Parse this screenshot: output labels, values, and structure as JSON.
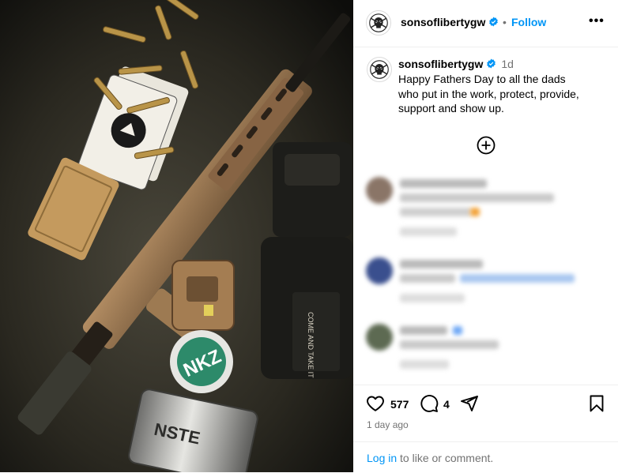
{
  "post": {
    "username": "sonsofliberty­gw",
    "follow_label": "Follow",
    "separator": "•",
    "more_glyph": "•••",
    "caption_time": "1d",
    "caption_text": "Happy Fathers Day to all the dads who put in the work, protect, provide, support and show up.",
    "likes": "577",
    "comments_count": "4",
    "posted_ago": "1 day ago",
    "login_link": "Log in",
    "login_suffix": " to like or comment."
  },
  "icons": {
    "verified": "verified-badge-icon",
    "more": "more-options-icon",
    "load_more": "plus-circle-icon",
    "like": "heart-icon",
    "comment": "comment-bubble-icon",
    "share": "paper-plane-icon",
    "save": "bookmark-icon"
  },
  "colors": {
    "accent": "#0095f6",
    "muted": "#737373",
    "verified": "#0095f6"
  }
}
